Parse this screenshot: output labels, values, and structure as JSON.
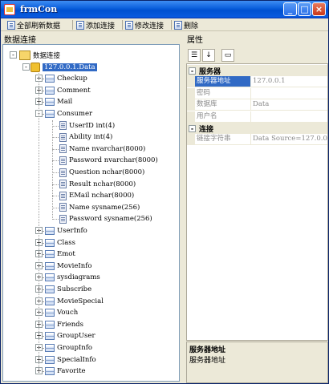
{
  "window": {
    "title": "frmCon"
  },
  "toolbar": {
    "refresh_all": "全部刷新数据",
    "add_connection": "添加连接",
    "edit_connection": "修改连接",
    "delete": "删除"
  },
  "left_panel": {
    "title": "数据连接"
  },
  "right_panel": {
    "title": "属性"
  },
  "tree": {
    "root": "数据连接",
    "database": "127.0.0.1.Data",
    "tables_before": [
      "Checkup",
      "Comment",
      "Mail"
    ],
    "expanded_table": "Consumer",
    "columns": [
      "UserID int(4)",
      "Ability int(4)",
      "Name nvarchar(8000)",
      "Password nvarchar(8000)",
      "Question nchar(8000)",
      "Result nchar(8000)",
      "EMail nchar(8000)",
      "Name sysname(256)",
      "Password sysname(256)"
    ],
    "tables_after": [
      "UserInfo",
      "Class",
      "Emot",
      "MovieInfo",
      "sysdiagrams",
      "Subscribe",
      "MovieSpecial",
      "Vouch",
      "Friends",
      "GroupUser",
      "GroupInfo",
      "SpecialInfo",
      "Favorite"
    ]
  },
  "property_grid": {
    "categories": [
      {
        "name": "服务器",
        "rows": [
          {
            "name": "服务器地址",
            "value": "127.0.0.1",
            "selected": true
          },
          {
            "name": "密码",
            "value": ""
          },
          {
            "name": "数据库",
            "value": "Data"
          },
          {
            "name": "用户名",
            "value": ""
          }
        ]
      },
      {
        "name": "连接",
        "rows": [
          {
            "name": "链接字符串",
            "value": "Data Source=127.0.0.1"
          }
        ]
      }
    ],
    "description": {
      "title": "服务器地址",
      "text": "服务器地址"
    }
  }
}
